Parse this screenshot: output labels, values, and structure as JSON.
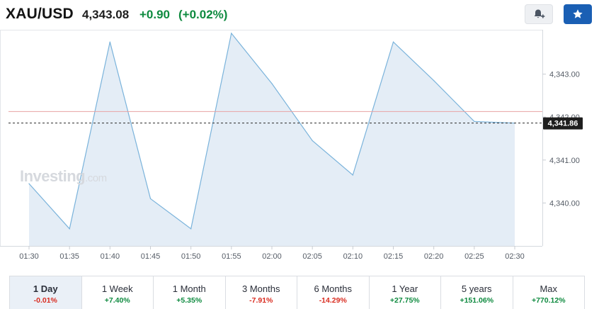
{
  "header": {
    "symbol": "XAU/USD",
    "price": "4,343.08",
    "change": "+0.90",
    "change_pct": "(+0.02%)",
    "alert_icon": "bell-plus-icon",
    "watchlist_icon": "star-icon"
  },
  "watermark": {
    "brand": "Investing",
    "suffix": ".com"
  },
  "colors": {
    "line": "#7ab3db",
    "area": "#e4edf6",
    "positive": "#0e8a3f",
    "negative": "#d92c20",
    "prev_close_line": "#e8a3a3",
    "price_tag": "#1e1e1e"
  },
  "chart_data": {
    "type": "area",
    "x": [
      "01:30",
      "01:35",
      "01:40",
      "01:45",
      "01:50",
      "01:55",
      "02:00",
      "02:05",
      "02:10",
      "02:15",
      "02:20",
      "02:25",
      "02:30"
    ],
    "values": [
      4340.45,
      4339.4,
      4343.75,
      4340.1,
      4339.4,
      4343.95,
      4342.78,
      4341.45,
      4340.65,
      4343.75,
      4342.85,
      4341.9,
      4341.86
    ],
    "y_ticks": [
      4340.0,
      4341.0,
      4342.0,
      4343.0
    ],
    "y_tick_labels": [
      "4,340.00",
      "4,341.00",
      "4,342.00",
      "4,343.00"
    ],
    "ylim": [
      4339.0,
      4344.0
    ],
    "prev_close": 4342.13,
    "last_price": 4341.86,
    "last_price_label": "4,341.86",
    "grid": false,
    "y_axis_side": "right"
  },
  "periods": [
    {
      "label": "1 Day",
      "change": "-0.01%",
      "direction": "neg",
      "active": true
    },
    {
      "label": "1 Week",
      "change": "+7.40%",
      "direction": "pos",
      "active": false
    },
    {
      "label": "1 Month",
      "change": "+5.35%",
      "direction": "pos",
      "active": false
    },
    {
      "label": "3 Months",
      "change": "-7.91%",
      "direction": "neg",
      "active": false
    },
    {
      "label": "6 Months",
      "change": "-14.29%",
      "direction": "neg",
      "active": false
    },
    {
      "label": "1 Year",
      "change": "+27.75%",
      "direction": "pos",
      "active": false
    },
    {
      "label": "5 years",
      "change": "+151.06%",
      "direction": "pos",
      "active": false
    },
    {
      "label": "Max",
      "change": "+770.12%",
      "direction": "pos",
      "active": false
    }
  ]
}
